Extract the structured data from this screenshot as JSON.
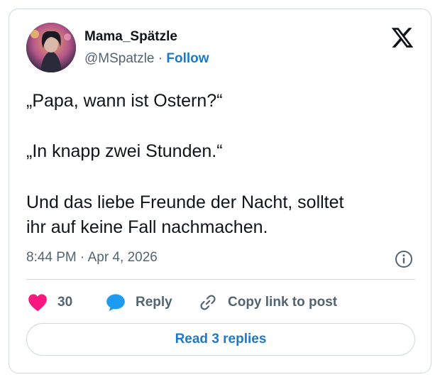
{
  "tweet": {
    "display_name": "Mama_Spätzle",
    "handle": "@MSpatzle",
    "separator": "·",
    "follow_label": "Follow",
    "text_lines": [
      "„Papa, wann ist Ostern?“",
      "„In knapp zwei Stunden.“",
      "Und das liebe Freunde der Nacht, solltet",
      "ihr auf keine Fall nachmachen."
    ],
    "timestamp": "8:44 PM · Apr 4, 2026"
  },
  "actions": {
    "like_count": "30",
    "reply_label": "Reply",
    "copy_label": "Copy link to post"
  },
  "read_replies_label": "Read 3 replies",
  "icons": {
    "brand": "x-logo-icon",
    "info": "info-icon",
    "like": "heart-icon",
    "reply": "speech-bubble-icon",
    "copy": "link-icon"
  },
  "colors": {
    "link_blue": "#1d79c8",
    "heart_pink": "#f91880",
    "reply_blue": "#1d9bf0",
    "muted": "#536471",
    "border": "#cfd9de"
  }
}
